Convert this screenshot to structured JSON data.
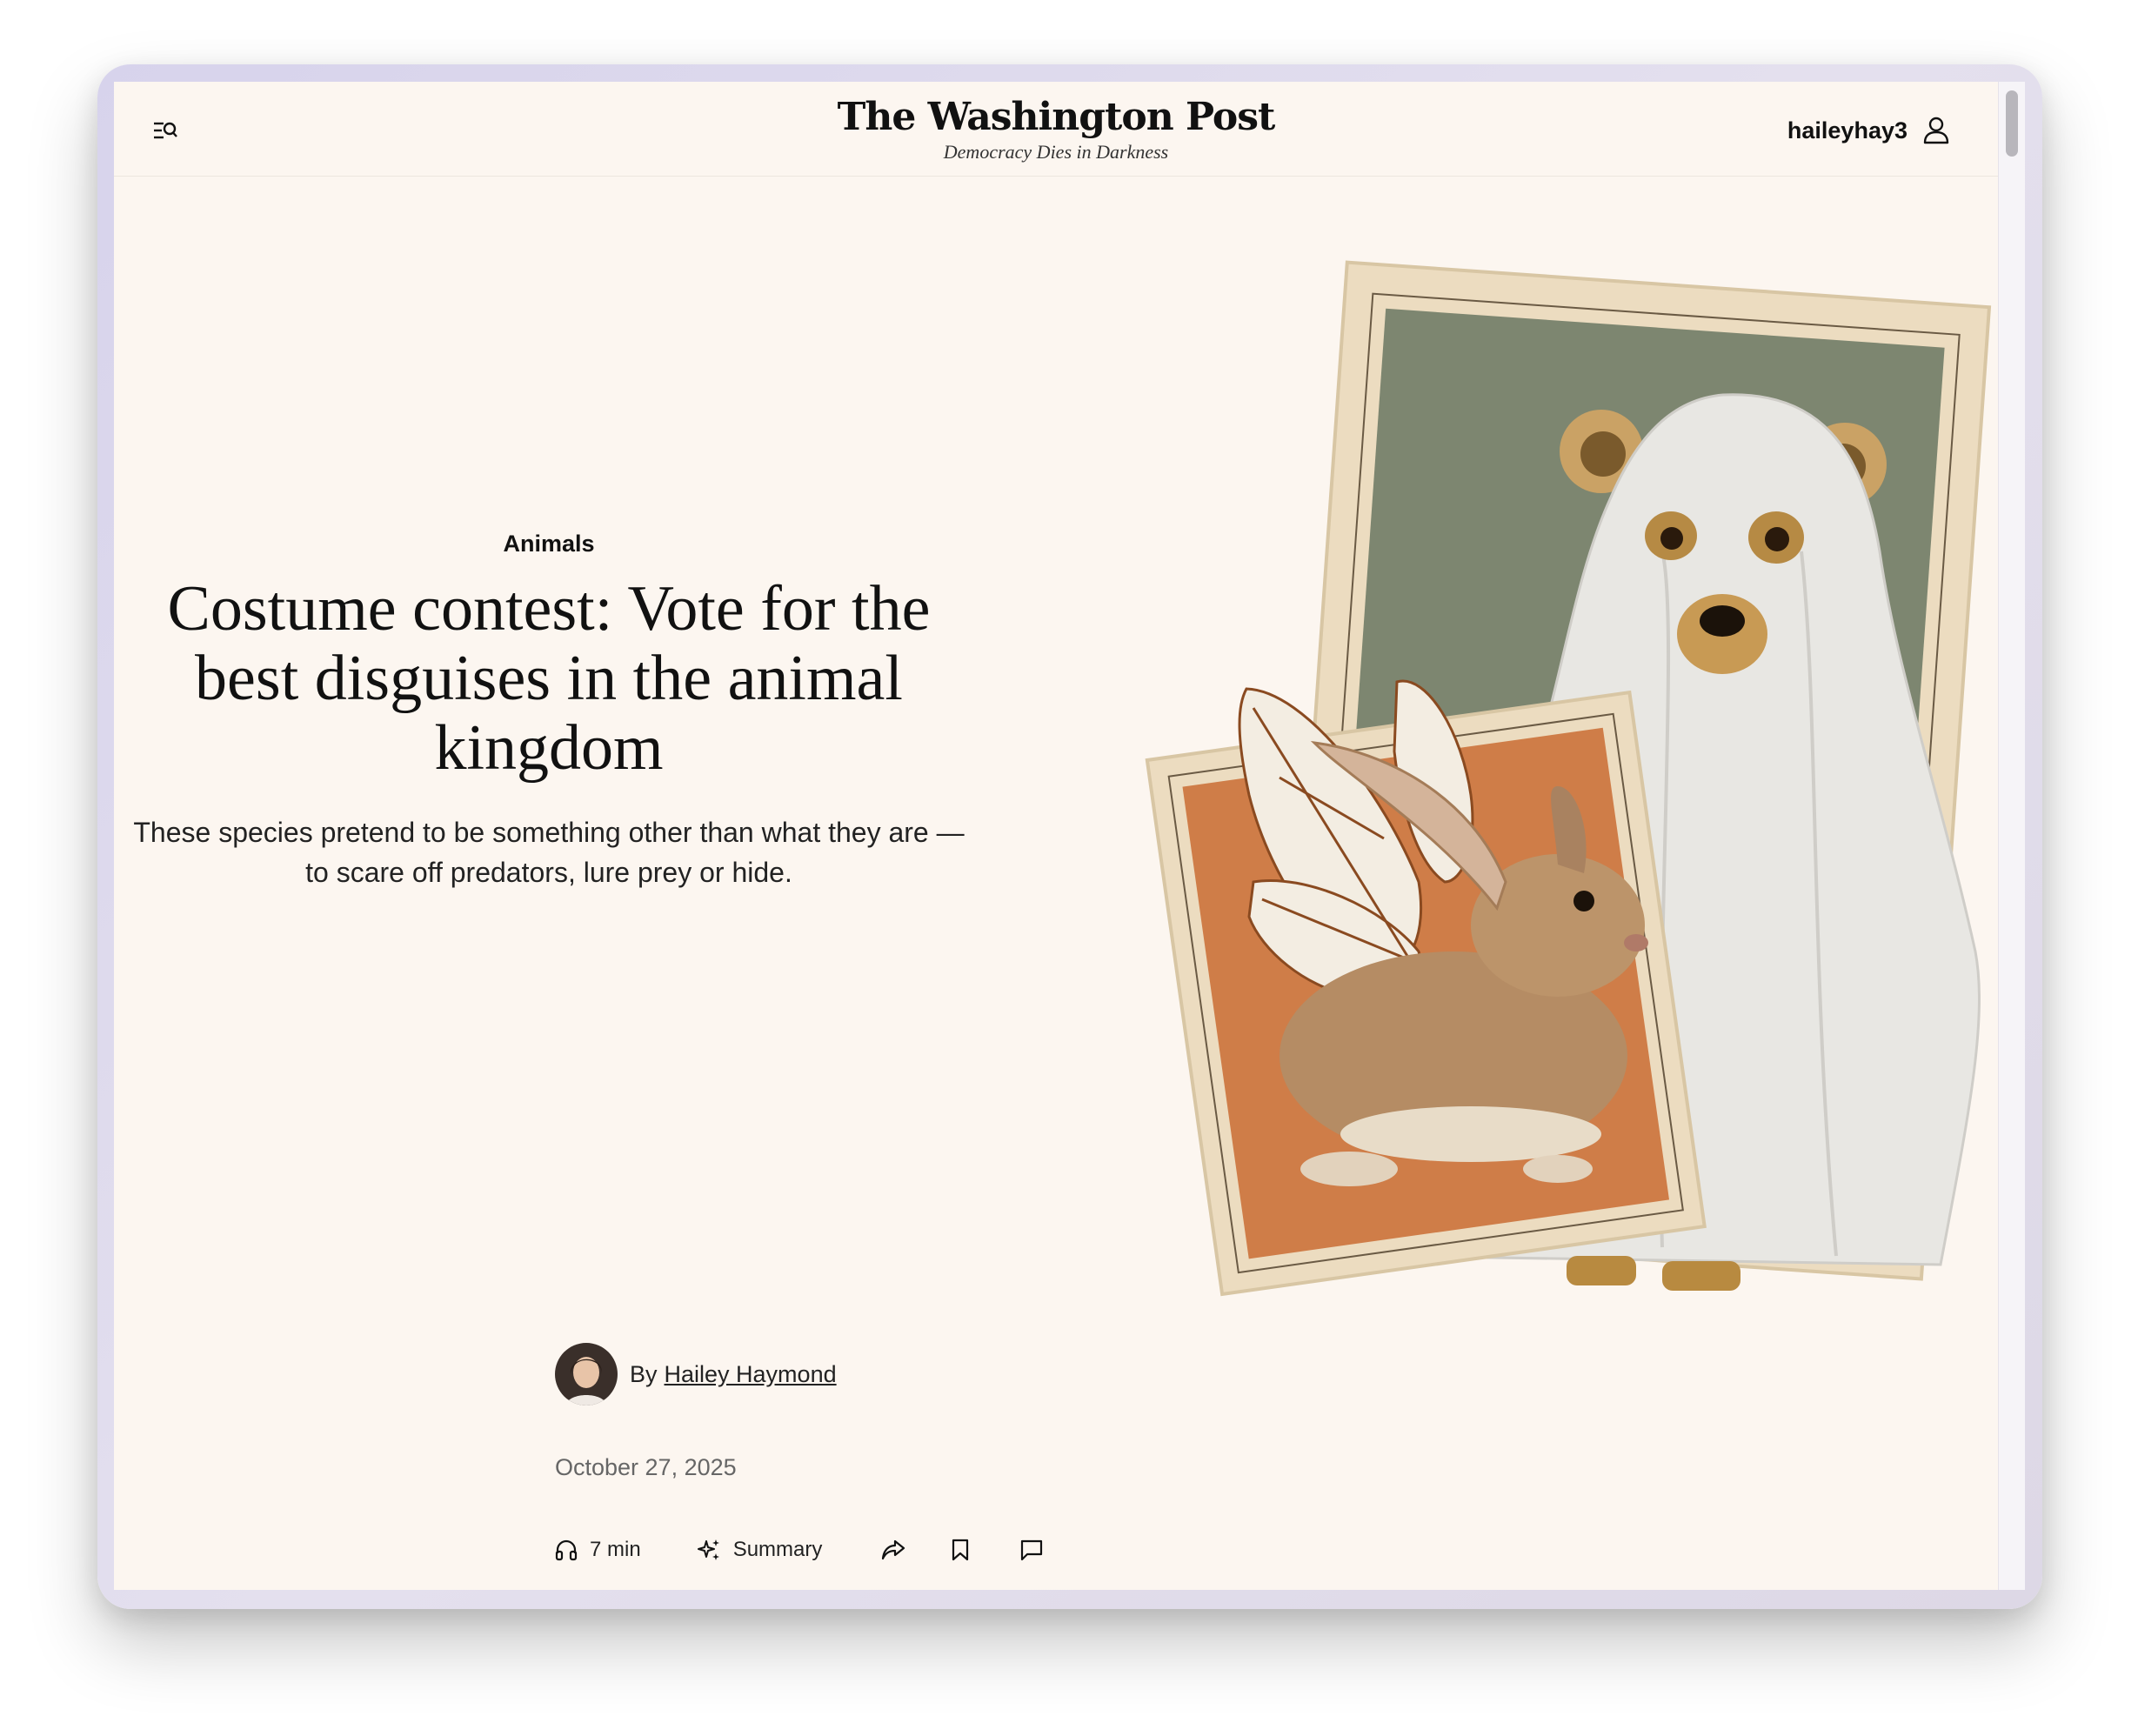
{
  "header": {
    "logo": "The Washington Post",
    "tagline": "Democracy Dies in Darkness",
    "username": "haileyhay3"
  },
  "article": {
    "kicker": "Animals",
    "headline": "Costume contest: Vote for the best disguises in the animal kingdom",
    "dek": "These species pretend to be something other than what they are — to scare off predators, lure prey or hide.",
    "byline_prefix": "By",
    "author": "Hailey Haymond",
    "date": "October 27, 2025"
  },
  "toolbar": {
    "listen_label": "7 min",
    "summary_label": "Summary"
  },
  "icons": {
    "menu": "menu-search-icon",
    "account": "user-icon",
    "listen": "headphones-icon",
    "summary": "sparkle-icon",
    "share": "share-arrow-icon",
    "save": "bookmark-icon",
    "comments": "comment-icon"
  },
  "colors": {
    "page_background": "#fcf6f0",
    "text": "#111111",
    "ghost_frame_bg": "#7d8670",
    "bunny_frame_bg": "#cf7d48"
  }
}
